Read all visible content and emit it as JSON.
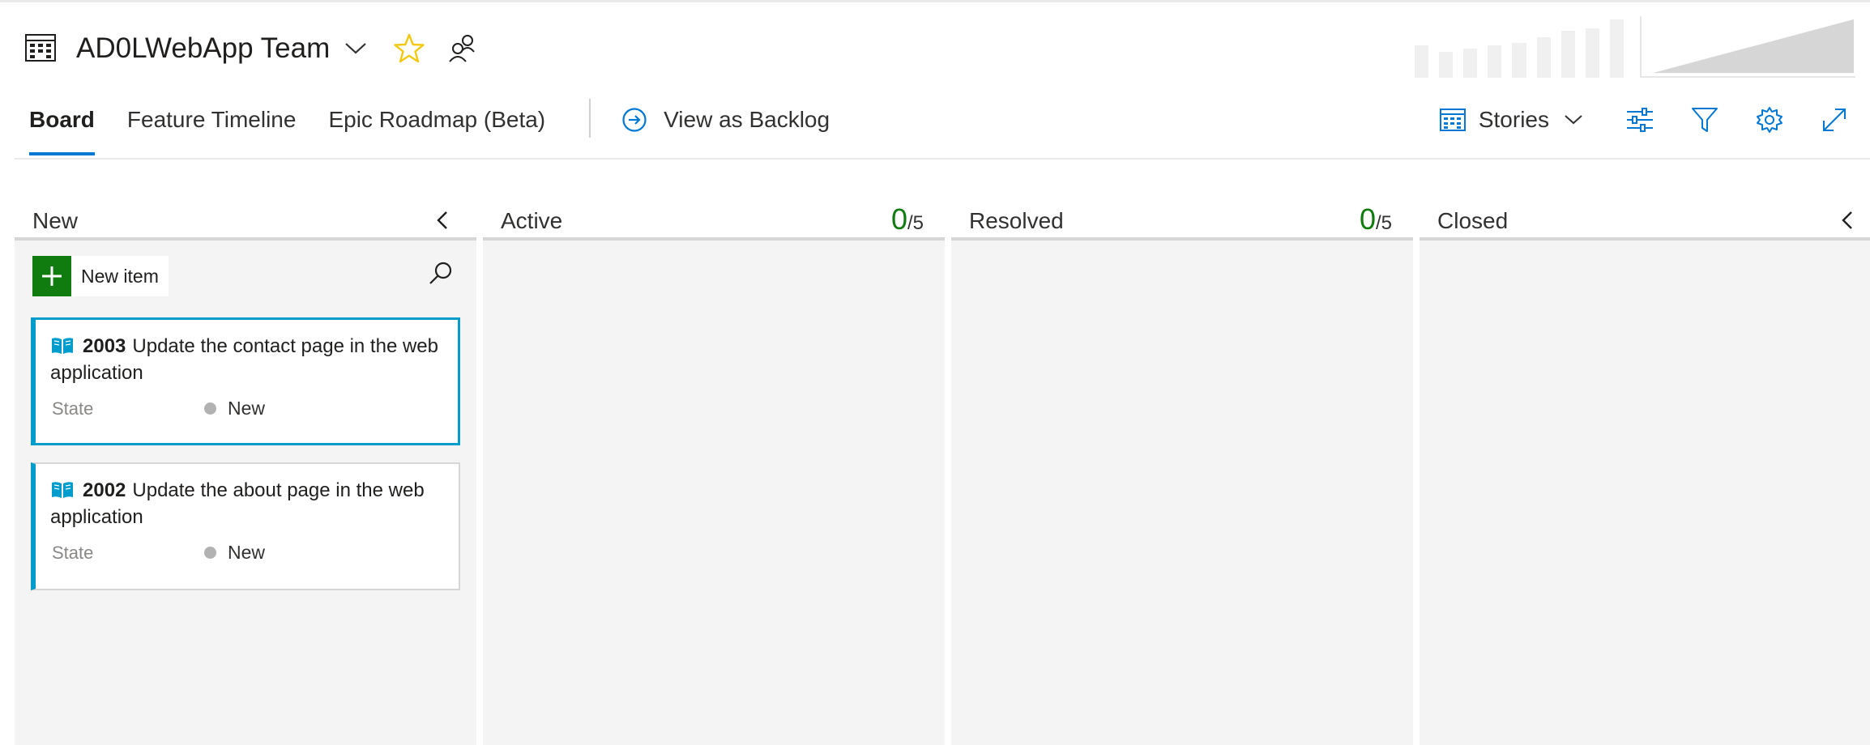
{
  "header": {
    "team_name": "AD0LWebApp Team"
  },
  "mini_chart": {
    "bar_levels": [
      0.55,
      0.45,
      0.5,
      0.55,
      0.6,
      0.7,
      0.8,
      0.85,
      1.0
    ]
  },
  "tabs": [
    {
      "label": "Board",
      "active": true
    },
    {
      "label": "Feature Timeline",
      "active": false
    },
    {
      "label": "Epic Roadmap (Beta)",
      "active": false
    }
  ],
  "backlog_link": "View as Backlog",
  "toolbar": {
    "backlog_level": "Stories"
  },
  "columns": [
    {
      "title": "New"
    },
    {
      "title": "Active",
      "count": "0",
      "limit": "/5"
    },
    {
      "title": "Resolved",
      "count": "0",
      "limit": "/5"
    },
    {
      "title": "Closed"
    }
  ],
  "new_item_label": "New item",
  "cards": [
    {
      "id": "2003",
      "title": "Update the contact page in the web application",
      "field_name": "State",
      "field_value": "New"
    },
    {
      "id": "2002",
      "title": "Update the about page in the web application",
      "field_name": "State",
      "field_value": "New"
    }
  ],
  "colors": {
    "accent": "#0078d4",
    "card_accent": "#009ccc",
    "add_green": "#107c10",
    "count_green": "#107c10",
    "star": "#f2c811"
  }
}
